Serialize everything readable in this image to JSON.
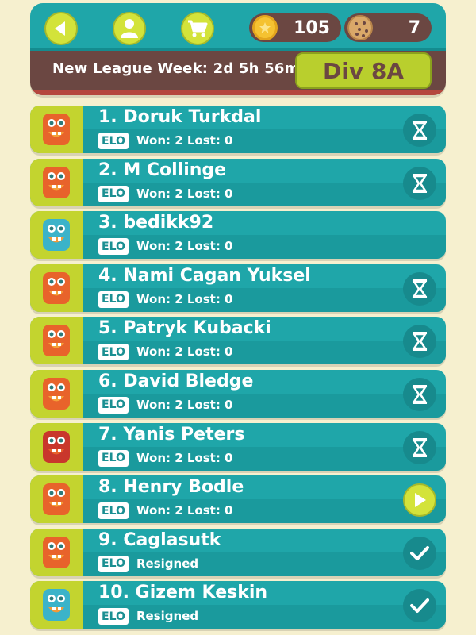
{
  "header": {
    "coins": "105",
    "cookies": "7",
    "league_week": "New League Week: 2d 5h 56m",
    "division": "Div 8A",
    "icons": {
      "back": "back-arrow-icon",
      "profile": "person-icon",
      "shop": "shopping-cart-icon",
      "coin": "coin-star-icon",
      "cookie": "cookie-icon"
    }
  },
  "colors": {
    "background": "#f6f0cf",
    "teal": "#1fa6a9",
    "lime": "#c3d42f",
    "brown": "#6b4742",
    "coin": "#f5c231"
  },
  "players": [
    {
      "name": "1. Doruk Turkdal",
      "badge": "ELO",
      "status": "Won: 2 Lost: 0",
      "action": "hourglass-icon",
      "avatar": "orange"
    },
    {
      "name": "2. M Collinge",
      "badge": "ELO",
      "status": "Won: 2 Lost: 0",
      "action": "hourglass-icon",
      "avatar": "orange"
    },
    {
      "name": "3. bedikk92",
      "badge": "ELO",
      "status": "Won: 2 Lost: 0",
      "action": "",
      "avatar": "teal"
    },
    {
      "name": "4. Nami Cagan Yuksel",
      "badge": "ELO",
      "status": "Won: 2 Lost: 0",
      "action": "hourglass-icon",
      "avatar": "orange"
    },
    {
      "name": "5. Patryk Kubacki",
      "badge": "ELO",
      "status": "Won: 2 Lost: 0",
      "action": "hourglass-icon",
      "avatar": "orange"
    },
    {
      "name": "6. David Bledge",
      "badge": "ELO",
      "status": "Won: 2 Lost: 0",
      "action": "hourglass-icon",
      "avatar": "orange"
    },
    {
      "name": "7. Yanis Peters",
      "badge": "ELO",
      "status": "Won: 2 Lost: 0",
      "action": "hourglass-icon",
      "avatar": "red"
    },
    {
      "name": "8. Henry Bodle",
      "badge": "ELO",
      "status": "Won: 2 Lost: 0",
      "action": "play-icon",
      "avatar": "orange"
    },
    {
      "name": "9. Caglasutk",
      "badge": "ELO",
      "status": "Resigned",
      "action": "checkmark-icon",
      "avatar": "orange"
    },
    {
      "name": "10. Gizem Keskin",
      "badge": "ELO",
      "status": "Resigned",
      "action": "checkmark-icon",
      "avatar": "teal"
    }
  ]
}
